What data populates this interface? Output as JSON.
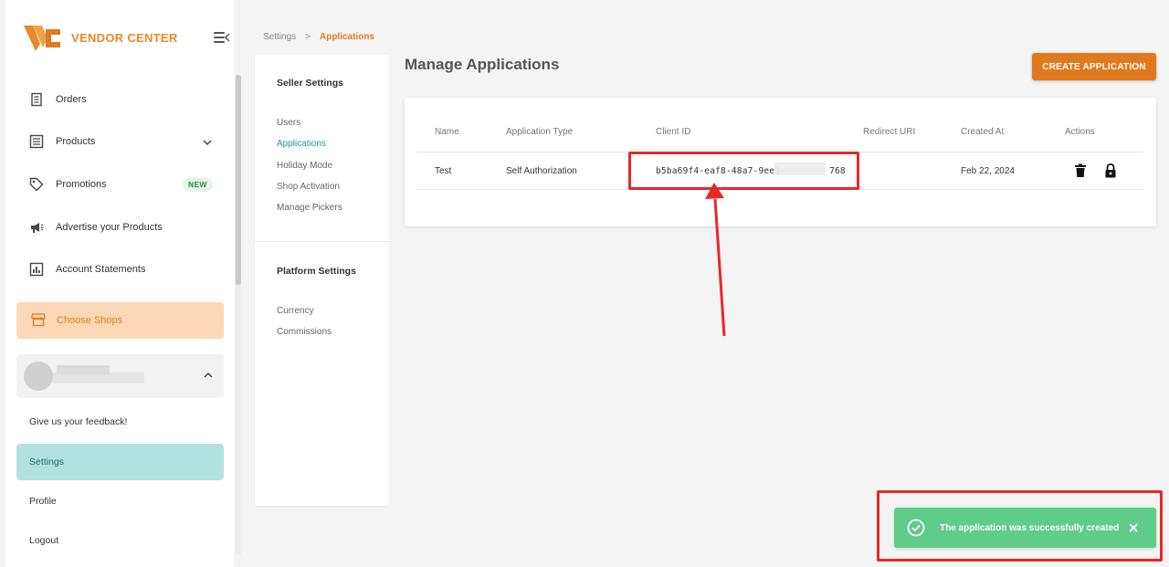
{
  "app": {
    "brand": "VENDOR CENTER",
    "accent": "#e07a1e",
    "teal": "#1f9a92"
  },
  "sidebar": {
    "items": [
      {
        "label": "Orders",
        "icon": "orders-icon"
      },
      {
        "label": "Products",
        "icon": "products-icon"
      },
      {
        "label": "Promotions",
        "icon": "tag-icon",
        "badge": "NEW"
      },
      {
        "label": "Advertise your Products",
        "icon": "megaphone-icon"
      },
      {
        "label": "Account Statements",
        "icon": "chart-icon"
      }
    ],
    "choose_shops": "Choose Shops",
    "feedback": "Give us your feedback!",
    "settings": "Settings",
    "profile": "Profile",
    "logout": "Logout"
  },
  "breadcrumb": {
    "root": "Settings",
    "separator": ">",
    "current": "Applications"
  },
  "settings_panel": {
    "seller_heading": "Seller Settings",
    "seller_links": [
      "Users",
      "Applications",
      "Holiday Mode",
      "Shop Activation",
      "Manage Pickers"
    ],
    "platform_heading": "Platform Settings",
    "platform_links": [
      "Currency",
      "Commissions"
    ]
  },
  "main": {
    "title": "Manage Applications",
    "create_button": "CREATE APPLICATION",
    "table": {
      "headers": [
        "Name",
        "Application Type",
        "Client ID",
        "Redirect URI",
        "Created At",
        "Actions"
      ],
      "rows": [
        {
          "name": "Test",
          "type": "Self Authorization",
          "client_id_prefix": "b5ba69f4-eaf8-48a7-9ee3-",
          "client_id_suffix": "768",
          "redirect_uri": "",
          "created_at": "Feb 22, 2024"
        }
      ]
    }
  },
  "toast": {
    "message": "The application was successfully created"
  }
}
